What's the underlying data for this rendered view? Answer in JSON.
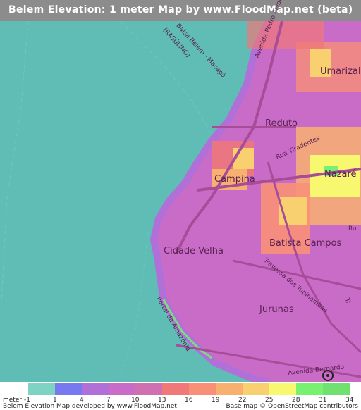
{
  "title": "Belem Elevation: 1 meter Map by www.FloodMap.net (beta)",
  "map": {
    "places": [
      {
        "id": "umarizal",
        "label": "Umarizal"
      },
      {
        "id": "reduto",
        "label": "Reduto"
      },
      {
        "id": "nazare",
        "label": "Nazaré"
      },
      {
        "id": "campina",
        "label": "Campina"
      },
      {
        "id": "cidade-velha",
        "label": "Cidade Velha"
      },
      {
        "id": "batista-campos",
        "label": "Batista Campos"
      },
      {
        "id": "jurunas",
        "label": "Jurunas"
      }
    ],
    "streets": [
      {
        "id": "avenida-pedro-alvares",
        "label": "Avenida Pedro Alvar"
      },
      {
        "id": "rua-tiradentes",
        "label": "Rua Tiradentes"
      },
      {
        "id": "travessa-tupinambas",
        "label": "Travessa dos Tupinambás"
      },
      {
        "id": "portal-amazonia",
        "label": "Portal da Amazônia"
      },
      {
        "id": "avenida-bernardo",
        "label": "Avenida Bernardo"
      },
      {
        "id": "balsa",
        "label": "Balsa Belém - Macapá"
      },
      {
        "id": "rasul",
        "label": "(RASÜLINO)"
      },
      {
        "id": "ru",
        "label": "Ru"
      },
      {
        "id": "tr",
        "label": "Tr"
      }
    ]
  },
  "legend": {
    "unit": "meter",
    "ticks": [
      "-1",
      "1",
      "4",
      "7",
      "10",
      "13",
      "16",
      "19",
      "22",
      "25",
      "28",
      "31",
      "34"
    ],
    "colors": [
      "#7fd3c3",
      "#7878f0",
      "#b070d8",
      "#c86cc8",
      "#d070b0",
      "#f07878",
      "#f89078",
      "#f8b070",
      "#f8d070",
      "#f8f870",
      "#78f070",
      "#70e070"
    ]
  },
  "credits": {
    "left": "Belem Elevation Map developed by www.FloodMap.net",
    "right": "Base map © OpenStreetMap contributors"
  }
}
